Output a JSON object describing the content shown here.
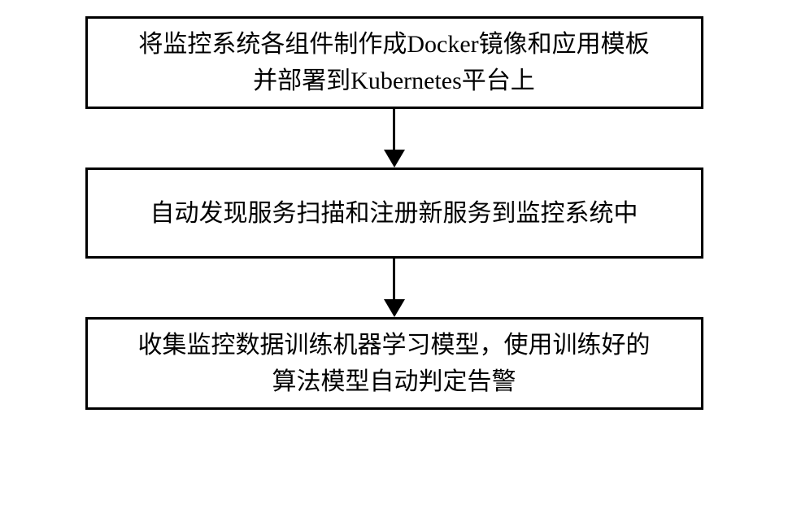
{
  "flowchart": {
    "steps": [
      {
        "text": "将监控系统各组件制作成Docker镜像和应用模板\n并部署到Kubernetes平台上"
      },
      {
        "text": "自动发现服务扫描和注册新服务到监控系统中"
      },
      {
        "text": "收集监控数据训练机器学习模型，使用训练好的\n算法模型自动判定告警"
      }
    ]
  }
}
